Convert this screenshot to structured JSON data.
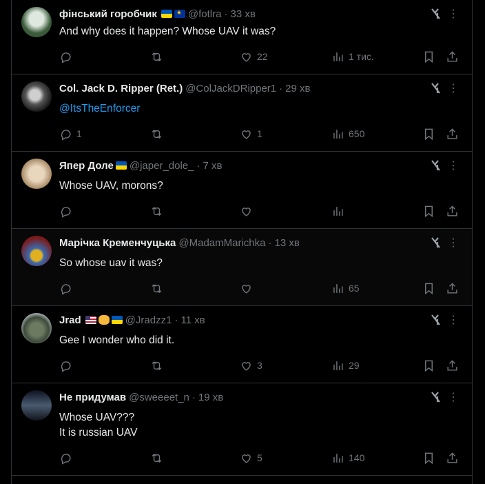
{
  "tweets": [
    {
      "name": "фінський горобчик",
      "name_badges": [
        "ua-flag",
        "eu-flag"
      ],
      "handle": "@fotlra",
      "time": "33 хв",
      "text": "And why does it happen? Whose UAV it was?",
      "mention": "",
      "replies": "",
      "reposts": "",
      "likes": "22",
      "views": "1 тис.",
      "avatar_color": "#3a5a3a"
    },
    {
      "name": "Col. Jack D. Ripper (Ret.)",
      "name_badges": [],
      "handle": "@ColJackDRipper1",
      "time": "29 хв",
      "text": "",
      "mention": "@ItsTheEnforcer",
      "replies": "1",
      "reposts": "",
      "likes": "1",
      "views": "650",
      "avatar_color": "#2a2a2a"
    },
    {
      "name": "Япер Доле",
      "name_badges": [
        "ua-flag"
      ],
      "handle": "@japer_dole_",
      "time": "7 хв",
      "text": "Whose UAV, morons?",
      "mention": "",
      "replies": "",
      "reposts": "",
      "likes": "",
      "views": "",
      "avatar_color": "#b89a78"
    },
    {
      "name": "Марічка Кременчуцька",
      "name_badges": [],
      "handle": "@MadamMarichka",
      "time": "13 хв",
      "text": "So whose uav it was?",
      "mention": "",
      "replies": "",
      "reposts": "",
      "likes": "",
      "views": "65",
      "avatar_color": "#8a2a2a"
    },
    {
      "name": "Jrad",
      "name_badges": [
        "us-flag",
        "handshake",
        "ua-flag"
      ],
      "handle": "@Jradzz1",
      "time": "11 хв",
      "text": "Gee I wonder who did it.",
      "mention": "",
      "replies": "",
      "reposts": "",
      "likes": "3",
      "views": "29",
      "avatar_color": "#4a5a48"
    },
    {
      "name": "Не придумав",
      "name_badges": [],
      "handle": "@sweeeet_n",
      "time": "19 хв",
      "text": "Whose UAV???",
      "text2": "It is russian UAV",
      "mention": "",
      "replies": "",
      "reposts": "",
      "likes": "5",
      "views": "140",
      "avatar_color": "#1e2a3a"
    }
  ],
  "icons": {
    "reply": "reply-icon",
    "repost": "repost-icon",
    "like": "like-icon",
    "views": "views-icon",
    "bookmark": "bookmark-icon",
    "share": "share-icon",
    "grok": "grok-icon",
    "more": "more-icon"
  },
  "colors": {
    "background": "#000000",
    "text": "#e7e9ea",
    "muted": "#71767b",
    "link": "#1d9bf0",
    "border": "#2f3336"
  },
  "more_glyph": "⋮"
}
